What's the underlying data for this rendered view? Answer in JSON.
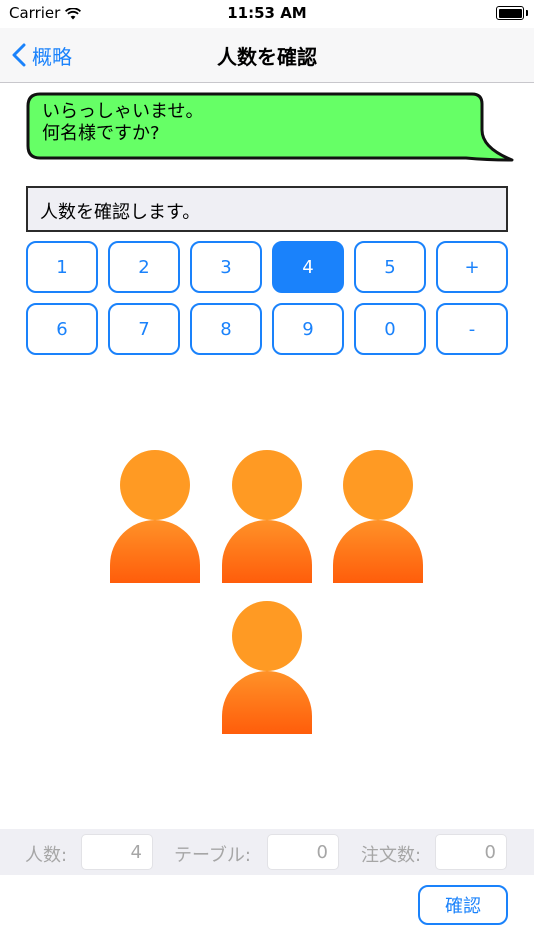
{
  "status_bar": {
    "carrier": "Carrier",
    "time": "11:53 AM",
    "icons": [
      "wifi-icon",
      "battery-icon"
    ]
  },
  "nav": {
    "back_label": "概略",
    "title": "人数を確認",
    "back_icon": "chevron-left-icon"
  },
  "message": {
    "lines": [
      "いらっしゃいませ。",
      "何名様ですか?"
    ],
    "bubble_color": "#66ff66"
  },
  "info_text": "人数を確認します。",
  "keypad": {
    "keys": [
      "1",
      "2",
      "3",
      "4",
      "5",
      "+",
      "6",
      "7",
      "8",
      "9",
      "0",
      "-"
    ],
    "selected": "4"
  },
  "people": {
    "count": 4,
    "icon": "person-icon"
  },
  "summary": {
    "people_label": "人数:",
    "people_value": "4",
    "table_label": "テーブル:",
    "table_value": "0",
    "orders_label": "注文数:",
    "orders_value": "0"
  },
  "confirm_label": "確認",
  "colors": {
    "accent": "#1a82fb",
    "person_head": "#ff9a23",
    "person_body_top": "#ff9228",
    "person_body_bottom": "#ff5d0b",
    "toolbar_bg": "#efeff4"
  }
}
